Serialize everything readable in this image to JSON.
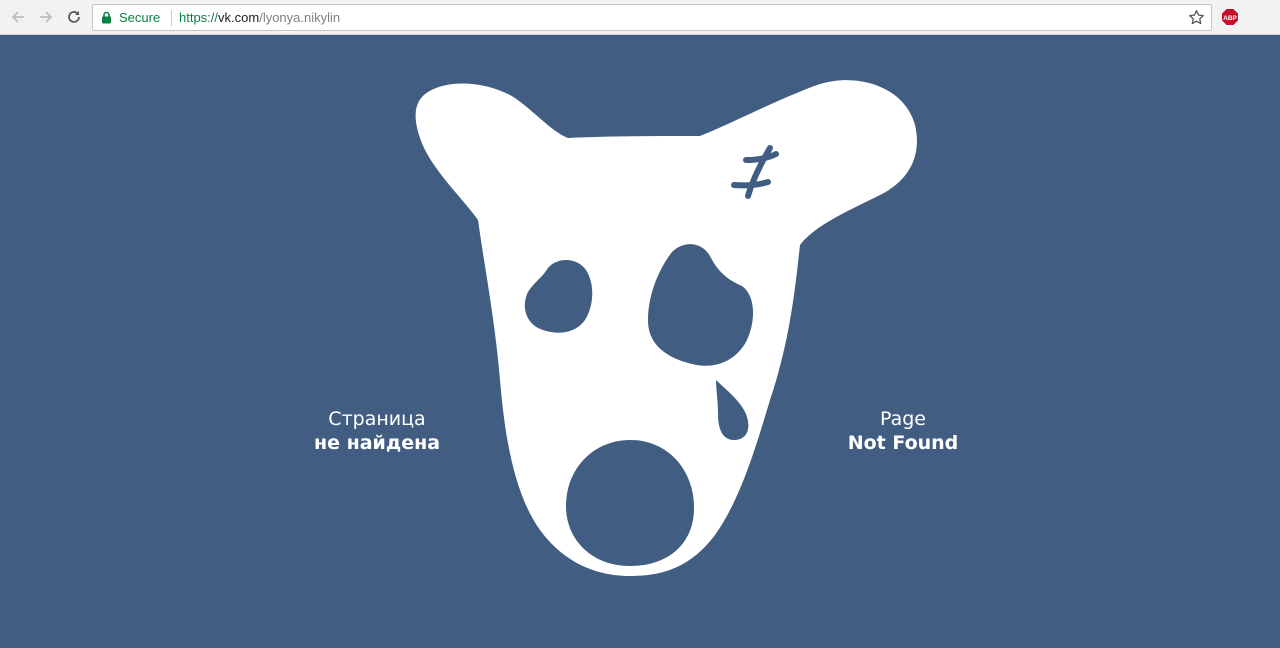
{
  "browser": {
    "secure_label": "Secure",
    "url_scheme": "https://",
    "url_host": "vk.com",
    "url_path": "/lyonya.nikylin",
    "icons": [
      "back-arrow-icon",
      "forward-arrow-icon",
      "reload-icon",
      "lock-icon",
      "bookmark-star-icon",
      "adblock-plus-icon"
    ],
    "extension_badge": "ABP"
  },
  "page": {
    "background_color": "#415e82",
    "ru": {
      "line1": "Страница",
      "line2": "не найдена"
    },
    "en": {
      "line1": "Page",
      "line2": "Not Found"
    }
  }
}
